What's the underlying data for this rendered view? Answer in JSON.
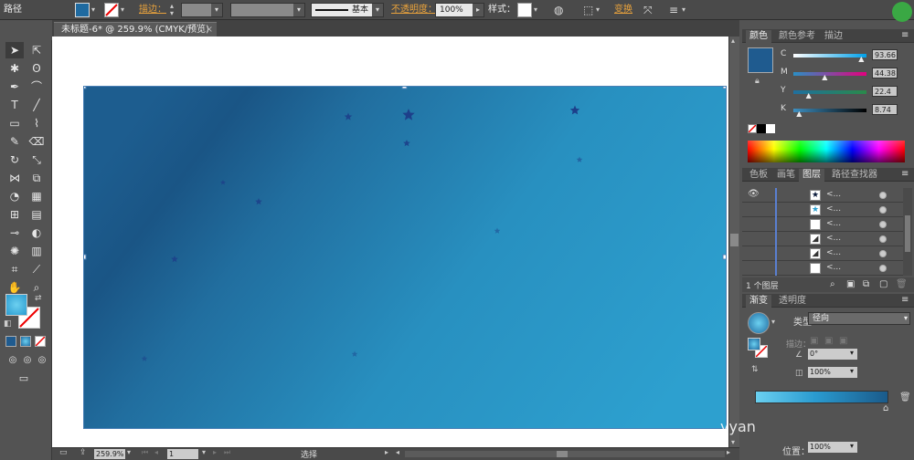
{
  "controlbar": {
    "object_type": "路径",
    "stroke_link": "描边：",
    "brush_label": "基本",
    "opacity_link": "不透明度：",
    "opacity_value": "100%",
    "style_label": "样式：",
    "transform_link": "变换"
  },
  "document": {
    "tab_title": "未标题-6* @ 259.9% (CMYK/预览)"
  },
  "statusbar": {
    "zoom": "259.9%",
    "artboard": "1",
    "mode": "选择"
  },
  "color_panel": {
    "tabs": [
      "颜色",
      "颜色参考",
      "描边"
    ],
    "channels": [
      {
        "label": "C",
        "value": "93.66",
        "fraction": 0.94,
        "gradient": "linear-gradient(90deg,#fff,#00a0e9)"
      },
      {
        "label": "M",
        "value": "44.38",
        "fraction": 0.44,
        "gradient": "linear-gradient(90deg,#2a8fc4,#e4007f)"
      },
      {
        "label": "Y",
        "value": "22.4",
        "fraction": 0.22,
        "gradient": "linear-gradient(90deg,#1f6f9f,#2a8a4a)"
      },
      {
        "label": "K",
        "value": "8.74",
        "fraction": 0.09,
        "gradient": "linear-gradient(90deg,#3e8fc0,#000)"
      }
    ],
    "fill_color": "#1f5b8f"
  },
  "layers_panel": {
    "tabs": [
      "色板",
      "画笔",
      "图层",
      "路径查找器"
    ],
    "rows": [
      {
        "name": "<...",
        "thumb": "star-dark-icon"
      },
      {
        "name": "<...",
        "thumb": "star-light-icon"
      },
      {
        "name": "<...",
        "thumb": "blank-icon"
      },
      {
        "name": "<...",
        "thumb": "slash-icon"
      },
      {
        "name": "<...",
        "thumb": "slash-icon"
      },
      {
        "name": "<...",
        "thumb": "blank-icon"
      }
    ],
    "count_text": "1 个图层"
  },
  "gradient_panel": {
    "tabs": [
      "渐变",
      "透明度"
    ],
    "type_label": "类型：",
    "type_value": "径向",
    "stroke_label": "描边：",
    "angle_value": "0°",
    "aspect_value": "100%",
    "position_label": "位置：",
    "position_value": "100%"
  },
  "colors": {
    "gradient_dark": "#1a5585",
    "gradient_light": "#2da0cf",
    "star_color": "#1d3f8a"
  },
  "watermark": {
    "text": "yyan"
  }
}
